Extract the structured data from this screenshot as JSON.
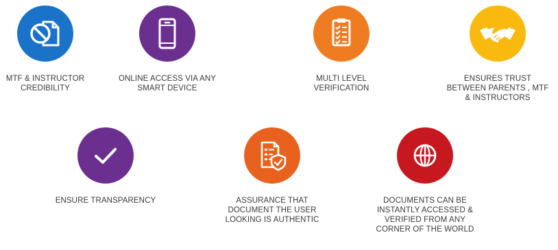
{
  "features": [
    {
      "label": "MTF & INSTRUCTOR\nCREDIBILITY",
      "icon": "document-ban-icon",
      "color": "#1a73c8"
    },
    {
      "label": "ONLINE ACCESS VIA ANY\nSMART DEVICE",
      "icon": "smartphone-icon",
      "color": "#6b2f8f"
    },
    {
      "label": "MULTI LEVEL\nVERIFICATION",
      "icon": "checklist-icon",
      "color": "#f07c22"
    },
    {
      "label": "ENSURES TRUST\nBETWEEN PARENTS , MTF\n& INSTRUCTORS",
      "icon": "handshake-icon",
      "color": "#f9b90f"
    },
    {
      "label": "ENSURE TRANSPARENCY",
      "icon": "checkmark-icon",
      "color": "#6b2f8f"
    },
    {
      "label": "ASSURANCE THAT\nDOCUMENT THE USER\nLOOKING IS AUTHENTIC",
      "icon": "document-shield-icon",
      "color": "#e8621d"
    },
    {
      "label": "DOCUMENTS CAN BE\nINSTANTLY ACCESSED &\nVERIFIED FROM ANY\nCORNER OF THE WORLD",
      "icon": "globe-icon",
      "color": "#c8181f"
    }
  ]
}
